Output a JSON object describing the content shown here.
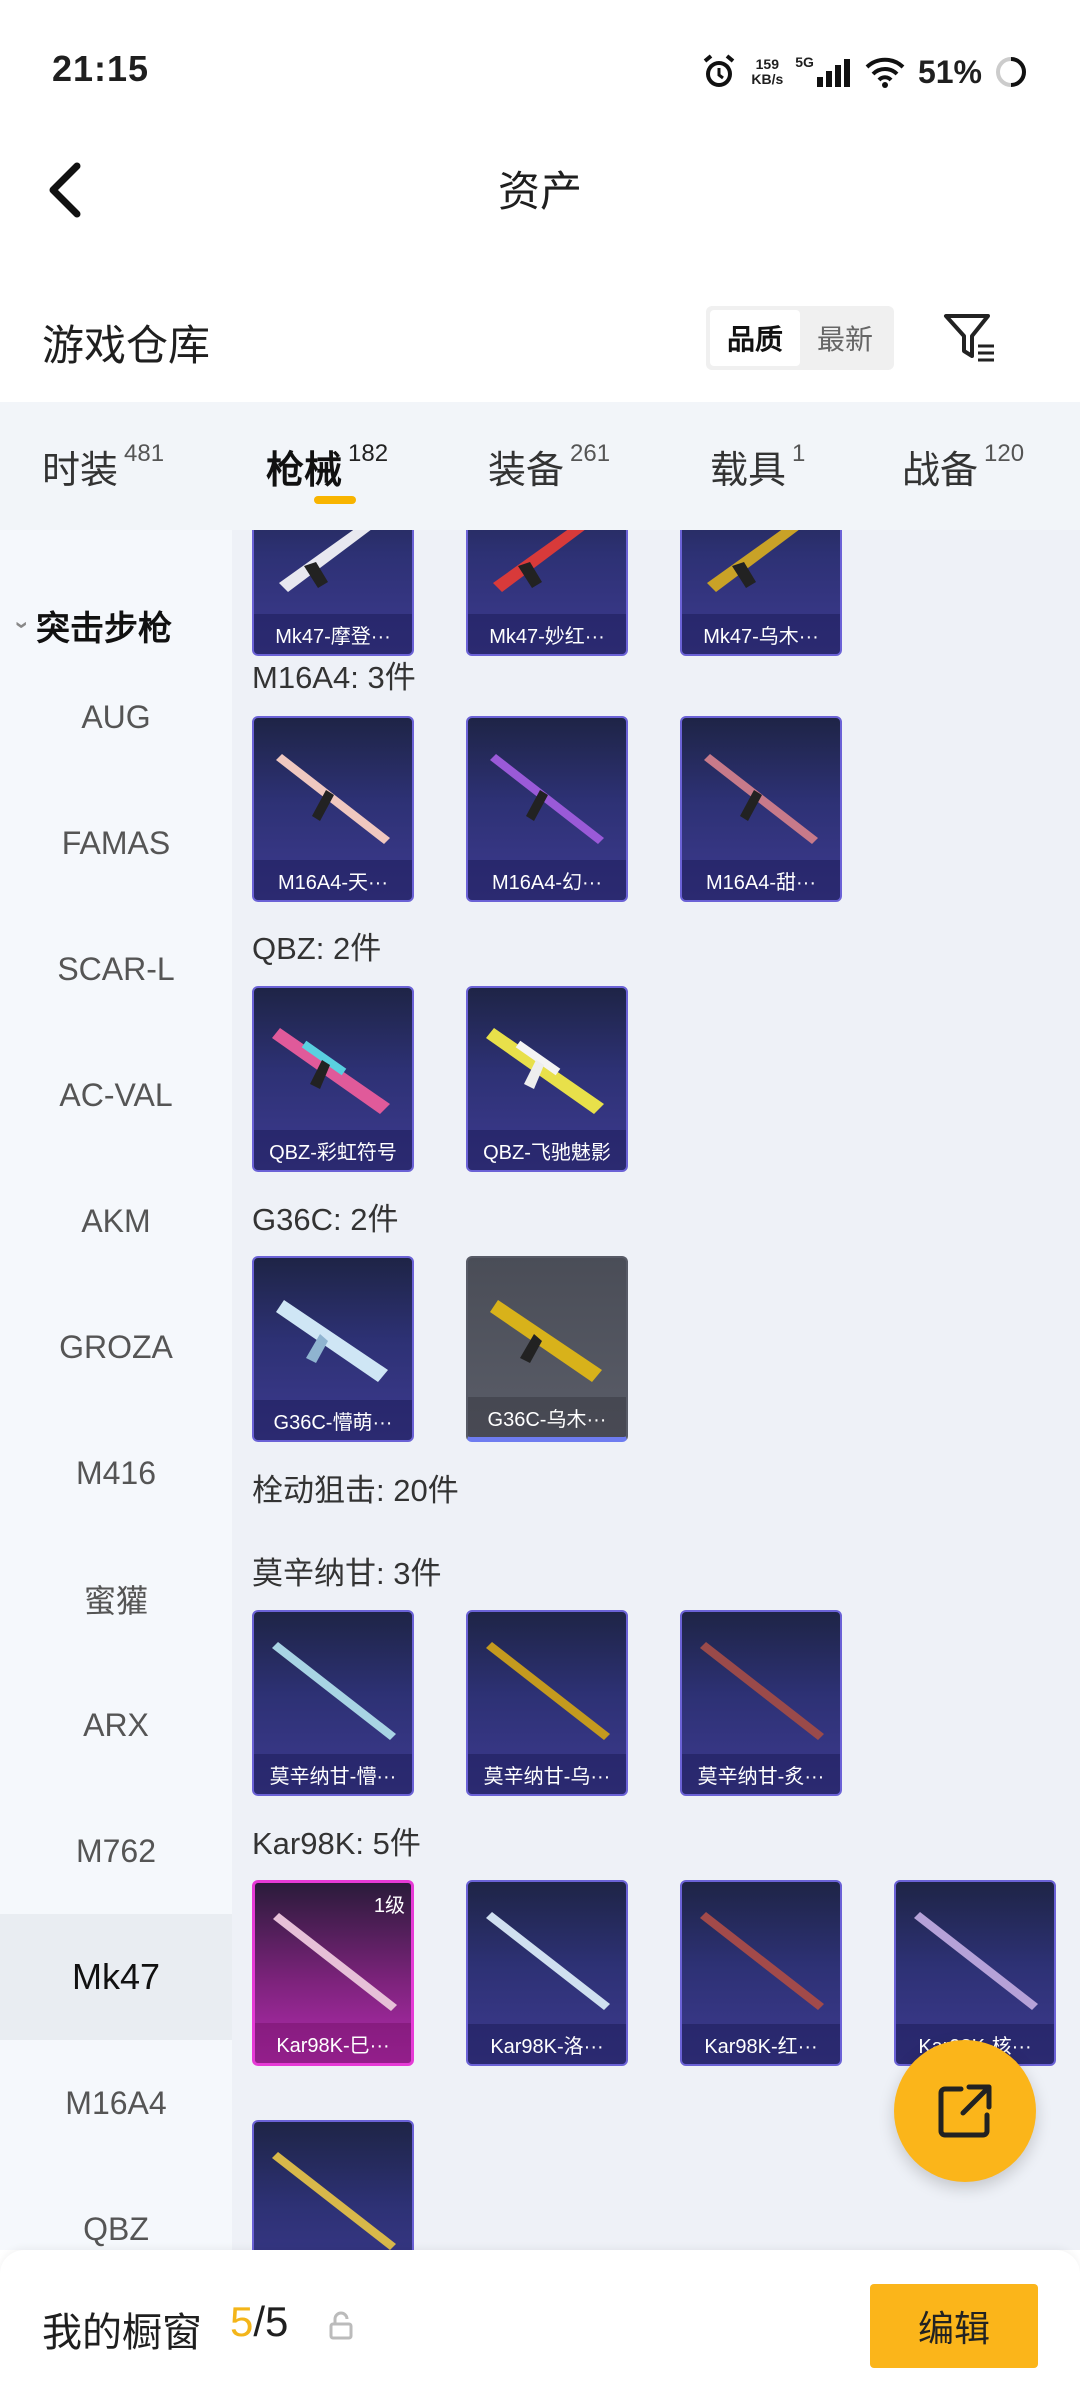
{
  "status_bar": {
    "time": "21:15",
    "net_speed_value": "159",
    "net_speed_unit": "KB/s",
    "network": "5G",
    "battery": "51%"
  },
  "header": {
    "title": "资产"
  },
  "section": {
    "title": "游戏仓库",
    "sort_options": [
      "品质",
      "最新"
    ],
    "active_sort": "品质"
  },
  "tabs": [
    {
      "label": "时装",
      "count": "481"
    },
    {
      "label": "枪械",
      "count": "182"
    },
    {
      "label": "装备",
      "count": "261"
    },
    {
      "label": "载具",
      "count": "1"
    },
    {
      "label": "战备",
      "count": "120"
    }
  ],
  "active_tab": "枪械",
  "sidebar": {
    "group": "突击步枪",
    "items": [
      "AUG",
      "FAMAS",
      "SCAR-L",
      "AC-VAL",
      "AKM",
      "GROZA",
      "M416",
      "蜜獾",
      "ARX",
      "M762",
      "Mk47",
      "M16A4",
      "QBZ"
    ],
    "selected": "Mk47"
  },
  "content": {
    "partial_row": [
      "Mk47-摩登···",
      "Mk47-妙红···",
      "Mk47-乌木···"
    ],
    "groups": [
      {
        "label": "M16A4: 3件",
        "items": [
          "M16A4-天···",
          "M16A4-幻···",
          "M16A4-甜···"
        ]
      },
      {
        "label": "QBZ: 2件",
        "items": [
          "QBZ-彩虹符号",
          "QBZ-飞驰魅影"
        ]
      },
      {
        "label": "G36C: 2件",
        "items": [
          "G36C-懵萌···",
          "G36C-乌木···"
        ]
      },
      {
        "label": "栓动狙击: 20件"
      },
      {
        "label": "莫辛纳甘: 3件",
        "items": [
          "莫辛纳甘-懵···",
          "莫辛纳甘-乌···",
          "莫辛纳甘-炙···"
        ]
      },
      {
        "label": "Kar98K: 5件",
        "items": [
          "Kar98K-巳···",
          "Kar98K-洛···",
          "Kar98K-红···",
          "Kar98K-核···"
        ],
        "level_badge": "1级"
      }
    ]
  },
  "bottom_bar": {
    "showcase_label": "我的橱窗",
    "showcase_current": "5",
    "showcase_sep_total": "/5",
    "edit_label": "编辑"
  },
  "colors": {
    "accent": "#fbb51a",
    "card_purple": "#3d3a8f",
    "card_border": "#6b62d6",
    "card_pink": "#e63ad6"
  }
}
